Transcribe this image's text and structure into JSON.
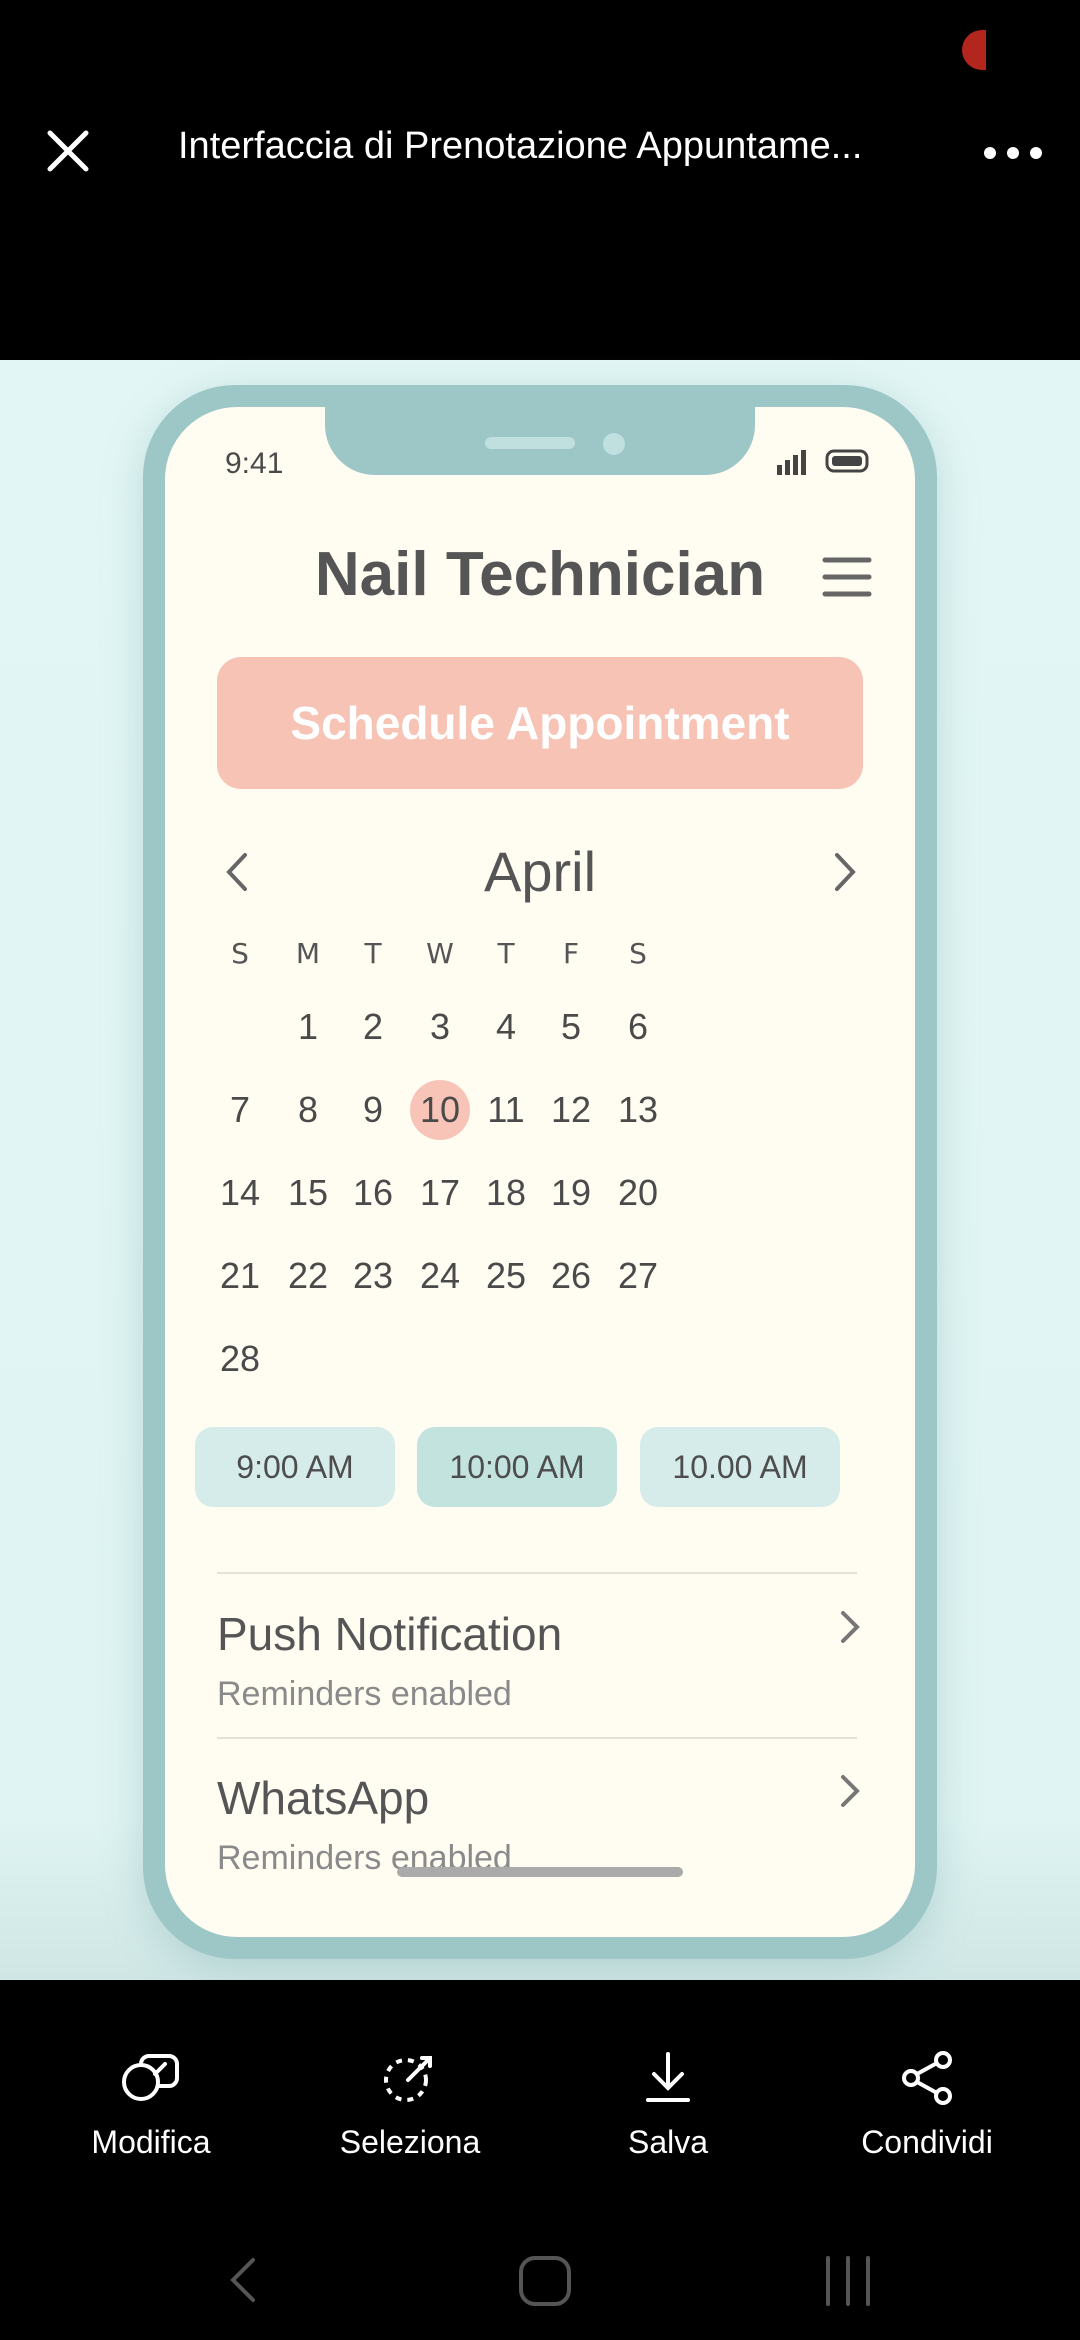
{
  "header": {
    "title": "Interfaccia di Prenotazione Appuntame..."
  },
  "phone": {
    "status_time": "9:41",
    "app_title": "Nail Technician",
    "schedule_button": "Schedule Appointment",
    "calendar": {
      "month": "April",
      "weekdays": [
        "S",
        "M",
        "T",
        "W",
        "T",
        "F",
        "S"
      ],
      "weeks": [
        [
          "",
          "1",
          "2",
          "3",
          "4",
          "5",
          "6"
        ],
        [
          "7",
          "8",
          "9",
          "10",
          "11",
          "12",
          "13"
        ],
        [
          "14",
          "15",
          "16",
          "17",
          "18",
          "19",
          "20"
        ],
        [
          "21",
          "22",
          "23",
          "24",
          "25",
          "26",
          "27"
        ],
        [
          "28",
          "",
          "",
          "",
          "",
          "",
          ""
        ]
      ],
      "selected_day": "10"
    },
    "time_slots": [
      "9:00 AM",
      "10:00 AM",
      "10.00 AM"
    ],
    "reminders": [
      {
        "title": "Push Notification",
        "subtitle": "Reminders enabled"
      },
      {
        "title": "WhatsApp",
        "subtitle": "Reminders enabled"
      }
    ]
  },
  "actions": {
    "edit": "Modifica",
    "select": "Seleziona",
    "save": "Salva",
    "share": "Condividi"
  },
  "colors": {
    "accent": "#f6c3b5",
    "phone_frame": "#9cc7c6",
    "slot": "#d5ecea",
    "background": "#e2f6f5"
  }
}
